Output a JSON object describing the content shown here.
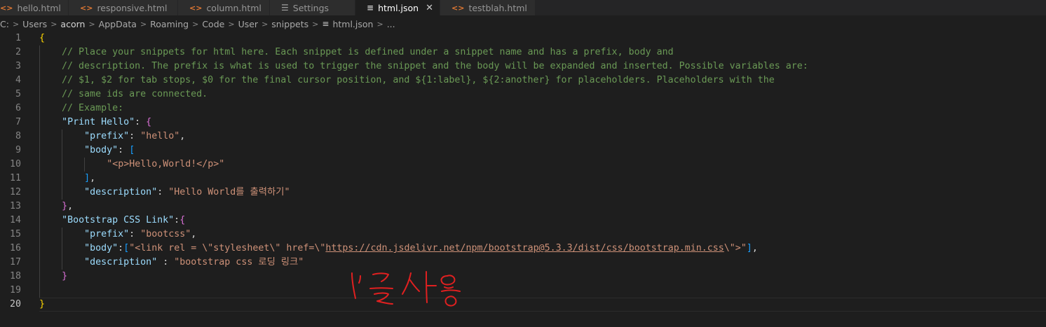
{
  "tabs": [
    {
      "label": "hello.html",
      "icon": "html-icon"
    },
    {
      "label": "responsive.html",
      "icon": "html-icon"
    },
    {
      "label": "column.html",
      "icon": "html-icon"
    },
    {
      "label": "Settings",
      "icon": "settings-icon"
    },
    {
      "label": "html.json",
      "icon": "json-icon",
      "active": true
    },
    {
      "label": "testblah.html",
      "icon": "html-icon"
    }
  ],
  "breadcrumb": [
    "C:",
    "Users",
    "acorn",
    "AppData",
    "Roaming",
    "Code",
    "User",
    "snippets",
    "html.json",
    "..."
  ],
  "editor": {
    "current_line": 20,
    "lines": [
      "{",
      "    // Place your snippets for html here. Each snippet is defined under a snippet name and has a prefix, body and",
      "    // description. The prefix is what is used to trigger the snippet and the body will be expanded and inserted. Possible variables are:",
      "    // $1, $2 for tab stops, $0 for the final cursor position, and ${1:label}, ${2:another} for placeholders. Placeholders with the",
      "    // same ids are connected.",
      "    // Example:",
      "    \"Print Hello\": {",
      "        \"prefix\": \"hello\",",
      "        \"body\": [",
      "            \"<p>Hello,World!</p>\"",
      "        ],",
      "        \"description\": \"Hello World를 출력하기\"",
      "    },",
      "    \"Bootstrap CSS Link\":{",
      "        \"prefix\": \"bootcss\",",
      "        \"body\":[\"<link rel = \\\"stylesheet\\\" href=\\\"https://cdn.jsdelivr.net/npm/bootstrap@5.3.3/dist/css/bootstrap.min.css\\\">\"],",
      "        \"description\" : \"bootstrap css 로딩 링크\"",
      "    }",
      "",
      "}"
    ]
  },
  "annotation": "!' 글 사용",
  "colors": {
    "background": "#1e1e1e",
    "comment": "#6a9955",
    "key": "#9cdcfe",
    "string": "#ce9178",
    "bracket_gold": "#ffd700",
    "bracket_orchid": "#da70d6",
    "bracket_blue": "#179fff",
    "annotation": "#e02020"
  }
}
